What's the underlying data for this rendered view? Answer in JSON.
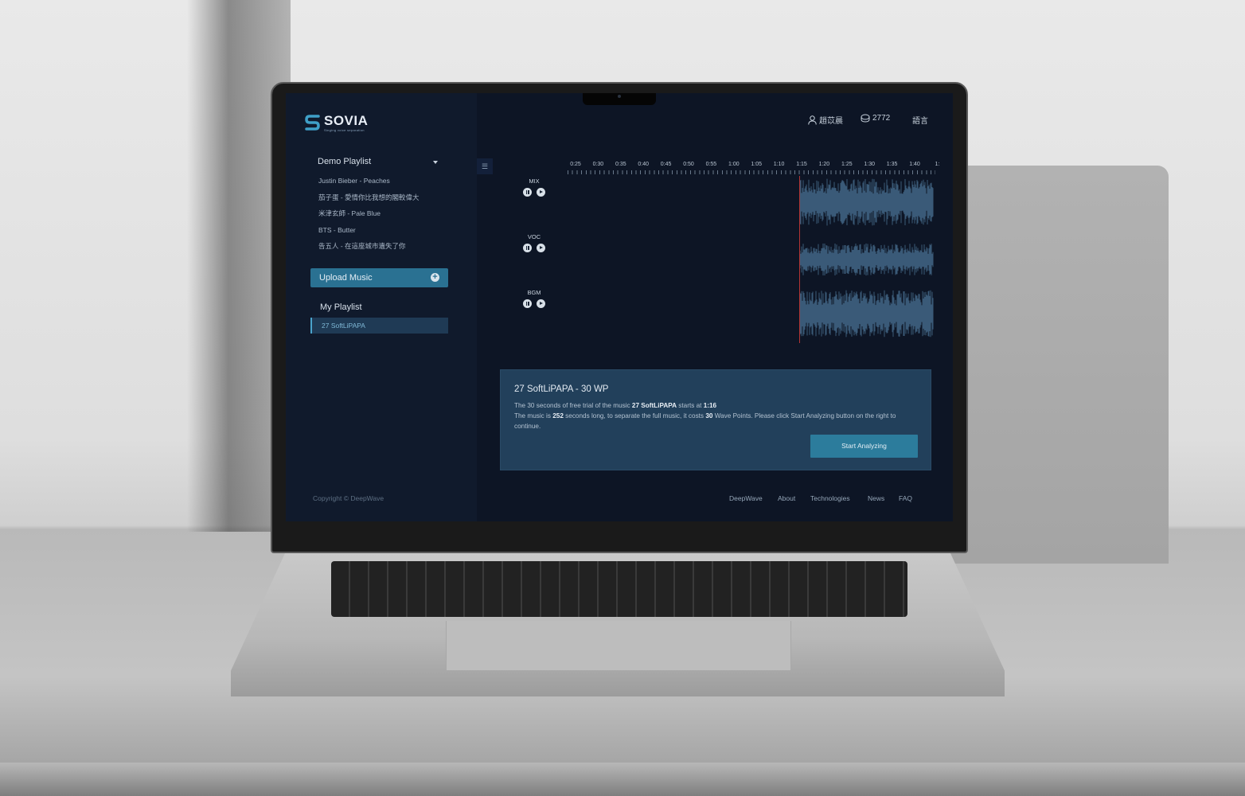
{
  "app": {
    "brand": "SOVIA",
    "tagline": "Singing voice separation"
  },
  "header": {
    "user_name": "趙苡晨",
    "points": "2772",
    "language_label": "語言"
  },
  "sidebar": {
    "demo_title": "Demo Playlist",
    "demo_items": [
      "Justin Bieber - Peaches",
      "茄子蛋 - 愛情你比我想的閣較偉大",
      "米津玄師 - Pale Blue",
      "BTS - Butter",
      "告五人 - 在這座城市遺失了你"
    ],
    "upload_label": "Upload Music",
    "my_title": "My Playlist",
    "my_items": [
      "27 SoftLiPAPA"
    ],
    "copyright": "Copyright © DeepWave"
  },
  "timeline": {
    "ticks": [
      "0:25",
      "0:30",
      "0:35",
      "0:40",
      "0:45",
      "0:50",
      "0:55",
      "1:00",
      "1:05",
      "1:10",
      "1:15",
      "1:20",
      "1:25",
      "1:30",
      "1:35",
      "1:40",
      "1:"
    ]
  },
  "tracks": [
    {
      "name": "MIX"
    },
    {
      "name": "VOC"
    },
    {
      "name": "BGM"
    }
  ],
  "info": {
    "title": "27 SoftLiPAPA - 30 WP",
    "line1_prefix": "The 30 seconds of free trial of the music ",
    "song": "27 SoftLiPAPA",
    "line1_mid": " starts at ",
    "start_time": "1:16",
    "line2_prefix": "The music is ",
    "duration": "252",
    "line2_mid": " seconds long, to separate the full music, it costs ",
    "cost": "30",
    "line2_suffix": " Wave Points. Please click Start Analyzing button on the right to continue.",
    "button_label": "Start Analyzing"
  },
  "footer": {
    "links": [
      "DeepWave",
      "About",
      "Technologies",
      "News",
      "FAQ"
    ]
  },
  "colors": {
    "background": "#0d1525",
    "sidebar": "#101a2c",
    "accent": "#2a7192",
    "panel": "#22405b",
    "playhead": "#b33434",
    "wave": "#3a5a78"
  }
}
